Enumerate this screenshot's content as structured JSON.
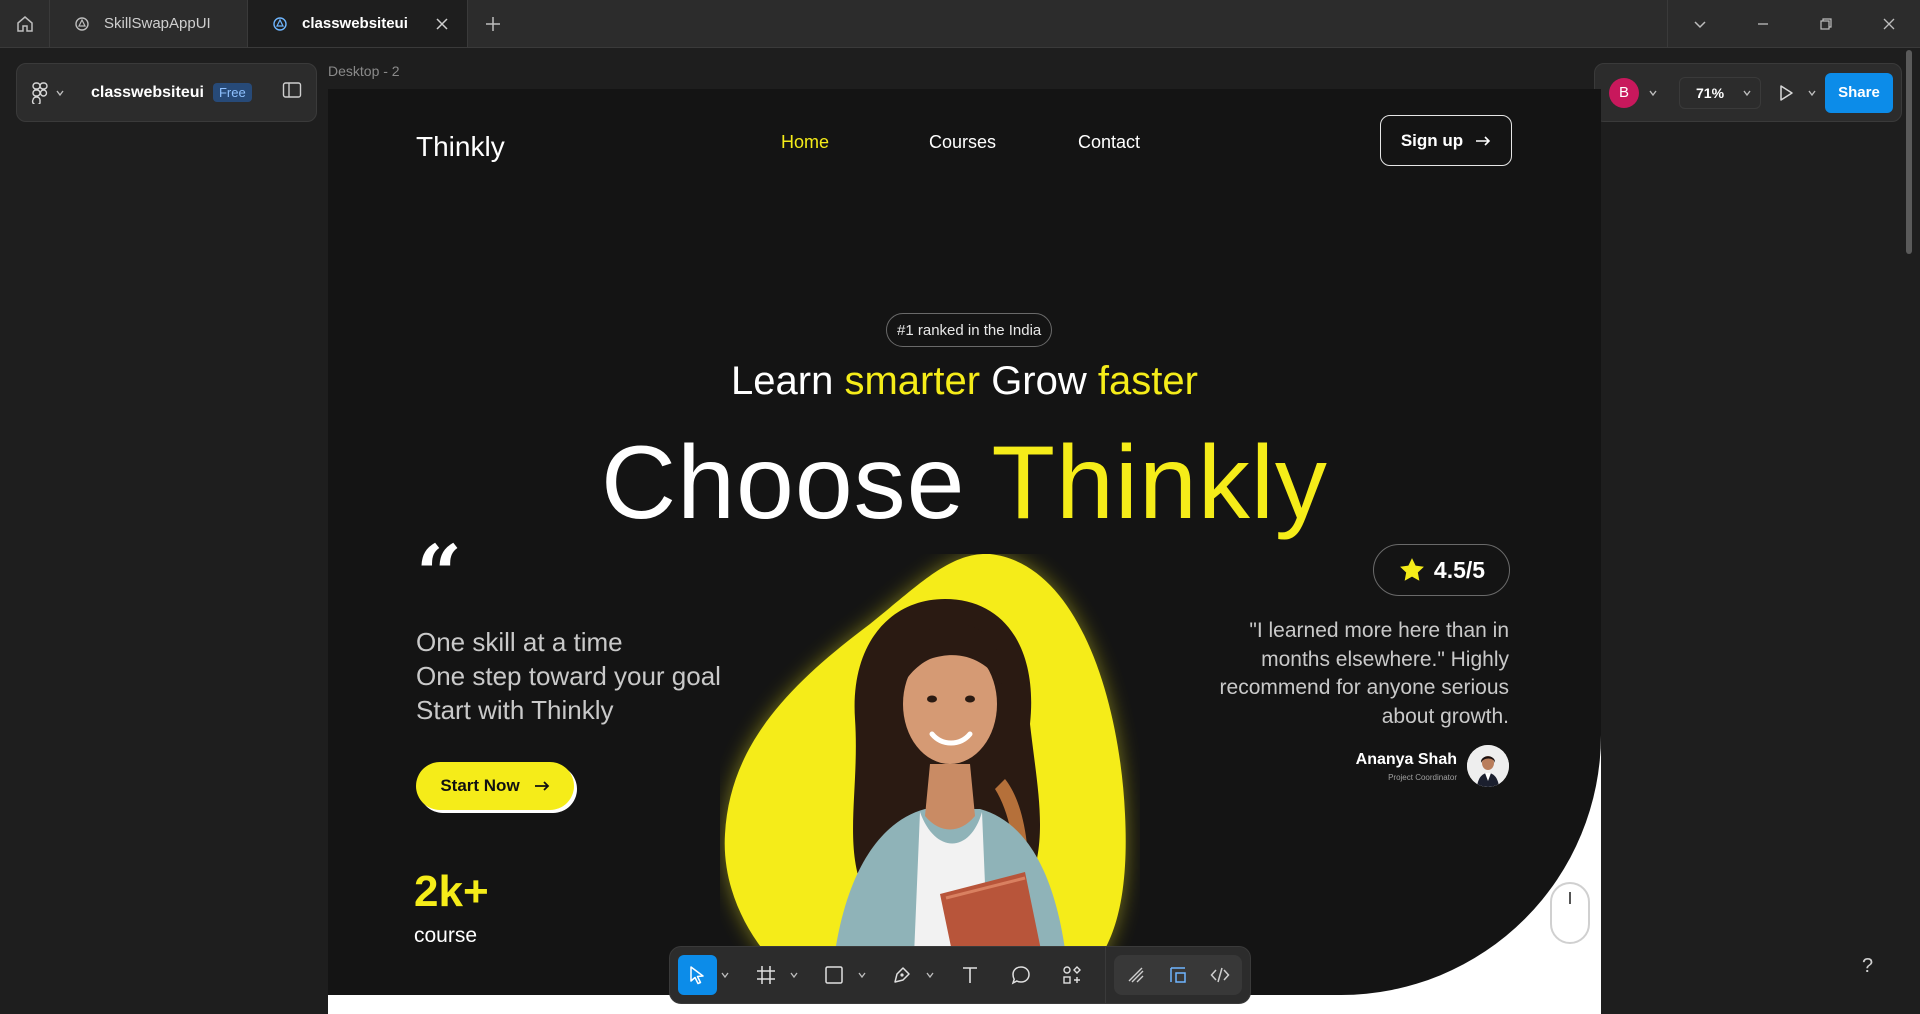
{
  "titlebar": {
    "tabs": [
      {
        "label": "SkillSwapAppUI",
        "active": false
      },
      {
        "label": "classwebsiteui",
        "active": true
      }
    ]
  },
  "filepanel": {
    "file_name": "classwebsiteui",
    "plan_badge": "Free"
  },
  "canvas": {
    "frame_label": "Desktop - 2"
  },
  "rightbar": {
    "avatar_initial": "B",
    "zoom": "71%",
    "share_label": "Share"
  },
  "design": {
    "brand": "Thinkly",
    "nav": {
      "home": "Home",
      "courses": "Courses",
      "contact": "Contact"
    },
    "signup_label": "Sign up",
    "rank_badge": "#1 ranked in the India",
    "tagline": {
      "w1": "Learn",
      "w2": "smarter",
      "w3": "Grow",
      "w4": "faster"
    },
    "title": {
      "w1": "Choose",
      "w2": "Thinkly"
    },
    "quote_mark": "“",
    "quote_lines": [
      "One skill at a time",
      "One step toward your goal",
      "Start with Thinkly"
    ],
    "start_label": "Start Now",
    "stat": {
      "value": "2k+",
      "label": "course"
    },
    "rating": "4.5/5",
    "testimonial": "\"I learned more here than in months elsewhere.\" Highly recommend for anyone serious about growth.",
    "author": {
      "name": "Ananya Shah",
      "role": "Project Coordinator"
    }
  },
  "help_label": "?",
  "colors": {
    "accent_yellow": "#f5ec19",
    "figma_blue": "#0c8ce9",
    "hero_bg": "#141414",
    "ui_panel": "#2c2c2c"
  }
}
